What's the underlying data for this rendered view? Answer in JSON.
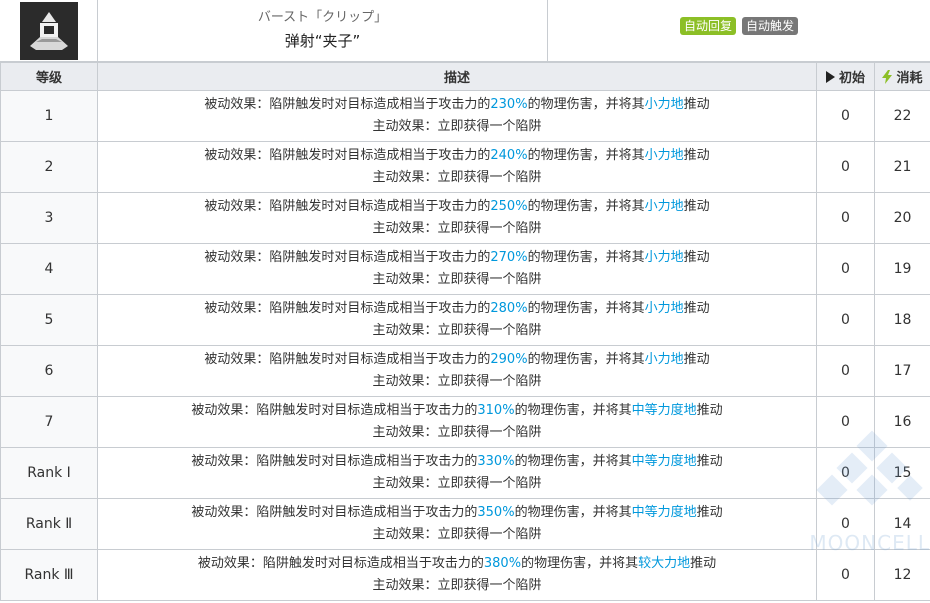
{
  "skill": {
    "name_jp": "バースト「クリップ」",
    "name_cn": "弹射“夹子”",
    "badges": [
      {
        "label": "自动回复",
        "color": "#8cbf26"
      },
      {
        "label": "自动触发",
        "color": "#777777"
      }
    ]
  },
  "table": {
    "headers": {
      "level": "等级",
      "desc": "描述",
      "initial": "初始",
      "cost": "消耗"
    },
    "rows": [
      {
        "level": "1",
        "pre": "被动效果：陷阱触发时对目标造成相当于攻击力的",
        "pct": "230%",
        "mid": "的物理伤害，并将其",
        "force": "小力地",
        "post": "推动",
        "active": "主动效果：立即获得一个陷阱",
        "initial": "0",
        "cost": "22"
      },
      {
        "level": "2",
        "pre": "被动效果：陷阱触发时对目标造成相当于攻击力的",
        "pct": "240%",
        "mid": "的物理伤害，并将其",
        "force": "小力地",
        "post": "推动",
        "active": "主动效果：立即获得一个陷阱",
        "initial": "0",
        "cost": "21"
      },
      {
        "level": "3",
        "pre": "被动效果：陷阱触发时对目标造成相当于攻击力的",
        "pct": "250%",
        "mid": "的物理伤害，并将其",
        "force": "小力地",
        "post": "推动",
        "active": "主动效果：立即获得一个陷阱",
        "initial": "0",
        "cost": "20"
      },
      {
        "level": "4",
        "pre": "被动效果：陷阱触发时对目标造成相当于攻击力的",
        "pct": "270%",
        "mid": "的物理伤害，并将其",
        "force": "小力地",
        "post": "推动",
        "active": "主动效果：立即获得一个陷阱",
        "initial": "0",
        "cost": "19"
      },
      {
        "level": "5",
        "pre": "被动效果：陷阱触发时对目标造成相当于攻击力的",
        "pct": "280%",
        "mid": "的物理伤害，并将其",
        "force": "小力地",
        "post": "推动",
        "active": "主动效果：立即获得一个陷阱",
        "initial": "0",
        "cost": "18"
      },
      {
        "level": "6",
        "pre": "被动效果：陷阱触发时对目标造成相当于攻击力的",
        "pct": "290%",
        "mid": "的物理伤害，并将其",
        "force": "小力地",
        "post": "推动",
        "active": "主动效果：立即获得一个陷阱",
        "initial": "0",
        "cost": "17"
      },
      {
        "level": "7",
        "pre": "被动效果：陷阱触发时对目标造成相当于攻击力的",
        "pct": "310%",
        "mid": "的物理伤害，并将其",
        "force": "中等力度地",
        "post": "推动",
        "active": "主动效果：立即获得一个陷阱",
        "initial": "0",
        "cost": "16"
      },
      {
        "level": "Rank Ⅰ",
        "pre": "被动效果：陷阱触发时对目标造成相当于攻击力的",
        "pct": "330%",
        "mid": "的物理伤害，并将其",
        "force": "中等力度地",
        "post": "推动",
        "active": "主动效果：立即获得一个陷阱",
        "initial": "0",
        "cost": "15"
      },
      {
        "level": "Rank Ⅱ",
        "pre": "被动效果：陷阱触发时对目标造成相当于攻击力的",
        "pct": "350%",
        "mid": "的物理伤害，并将其",
        "force": "中等力度地",
        "post": "推动",
        "active": "主动效果：立即获得一个陷阱",
        "initial": "0",
        "cost": "14"
      },
      {
        "level": "Rank Ⅲ",
        "pre": "被动效果：陷阱触发时对目标造成相当于攻击力的",
        "pct": "380%",
        "mid": "的物理伤害，并将其",
        "force": "较大力地",
        "post": "推动",
        "active": "主动效果：立即获得一个陷阱",
        "initial": "0",
        "cost": "12"
      }
    ]
  },
  "watermark": {
    "text": "MOONCELL"
  },
  "colors": {
    "highlight": "#0098dc",
    "header_bg": "#eaecf0",
    "level_bg": "#f8f9fa"
  }
}
